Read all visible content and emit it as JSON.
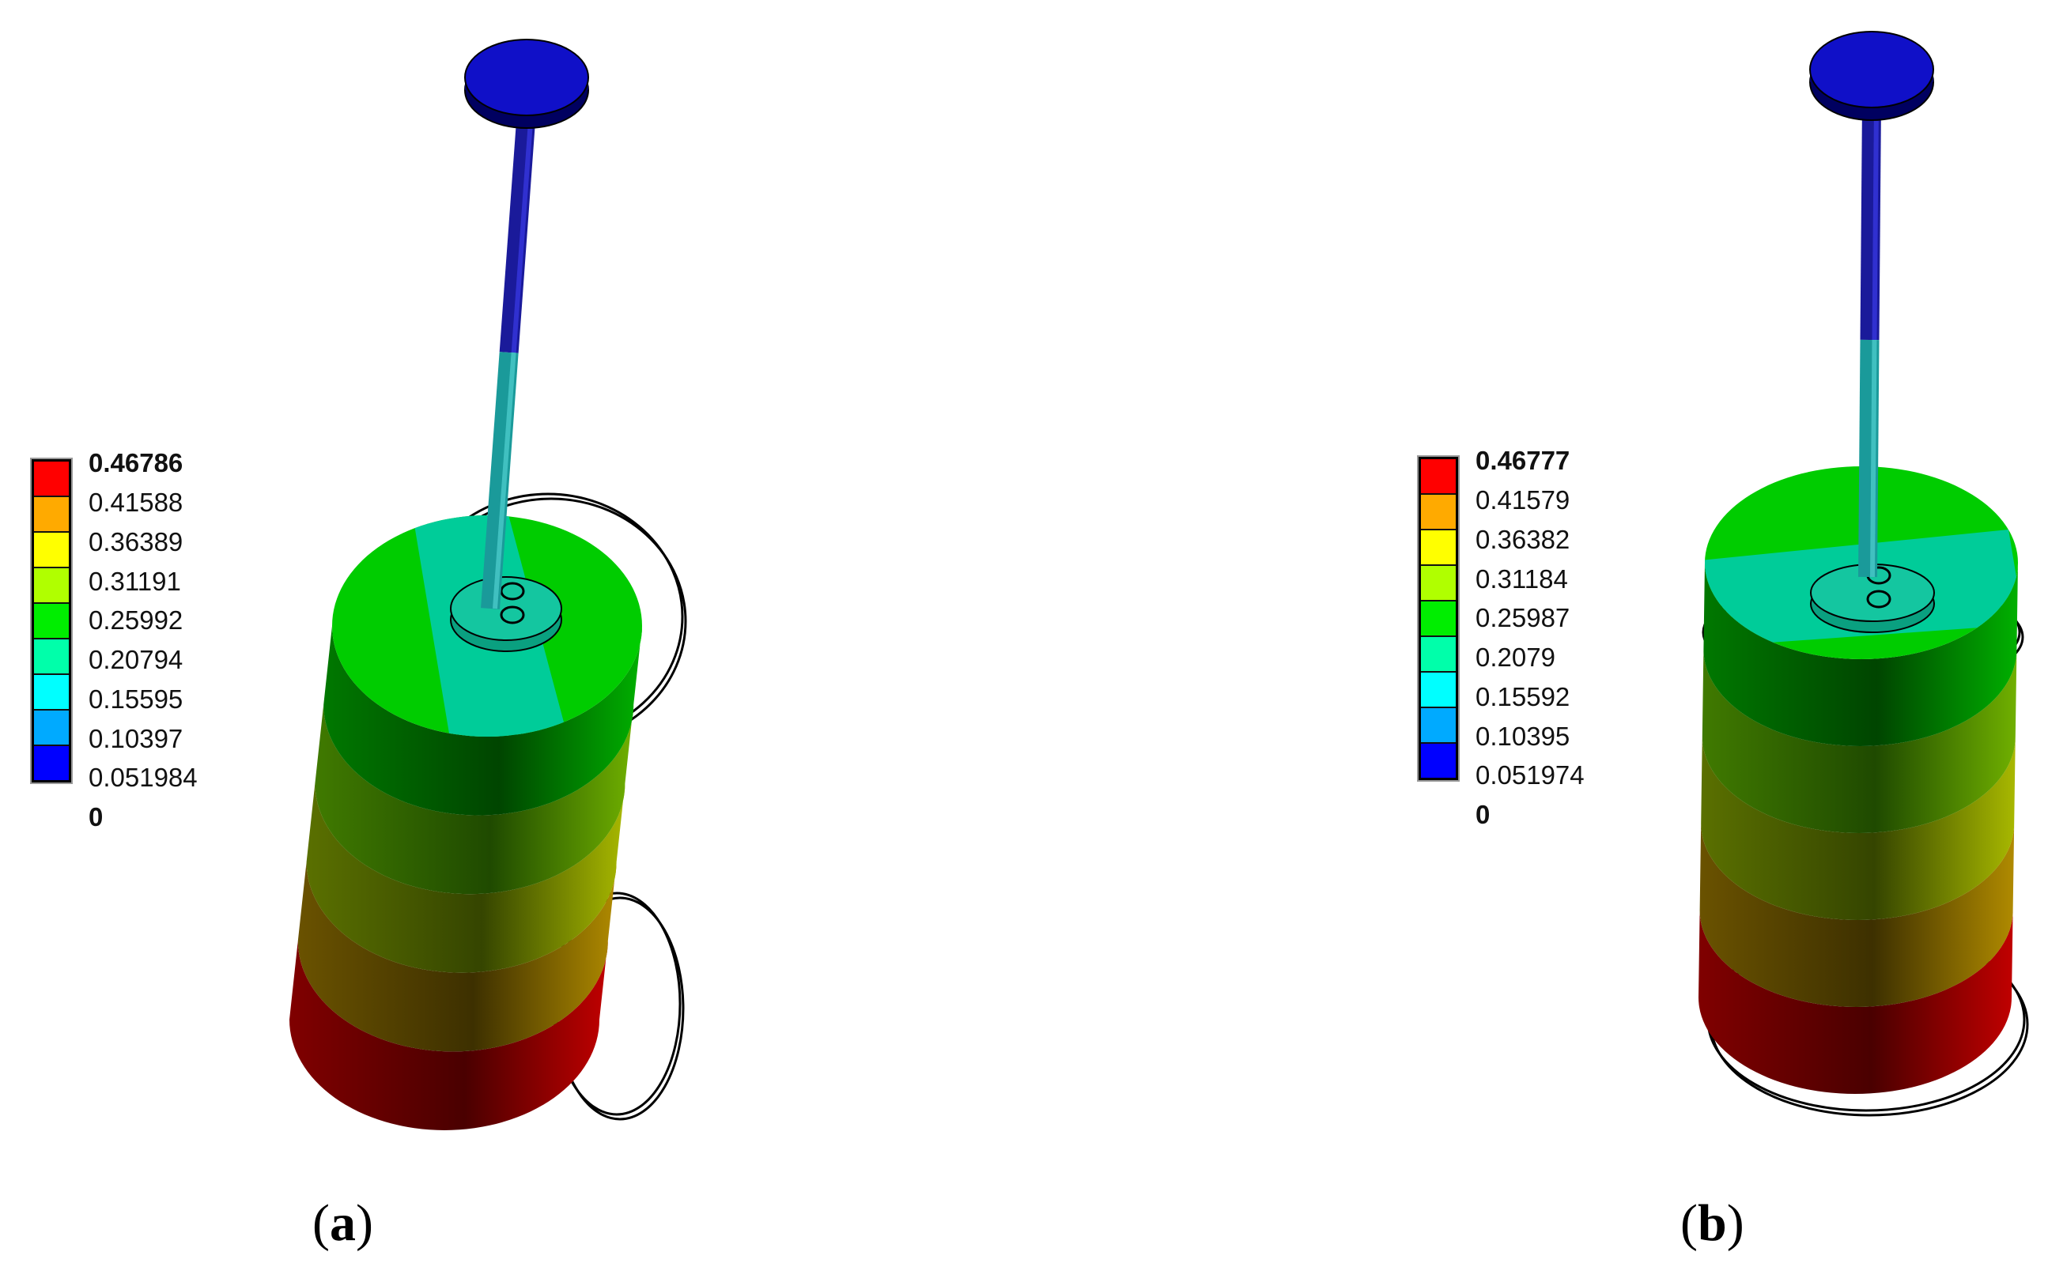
{
  "panels": [
    {
      "id": "a",
      "caption_open": "(",
      "caption_letter": "a",
      "caption_close": ")",
      "legend": [
        "0.46786",
        "0.41588",
        "0.36389",
        "0.31191",
        "0.25992",
        "0.20794",
        "0.15595",
        "0.10397",
        "0.051984",
        "0"
      ]
    },
    {
      "id": "b",
      "caption_open": "(",
      "caption_letter": "b",
      "caption_close": ")",
      "legend": [
        "0.46777",
        "0.41579",
        "0.36382",
        "0.31184",
        "0.25987",
        "0.2079",
        "0.15592",
        "0.10395",
        "0.051974",
        "0"
      ]
    }
  ],
  "colors": {
    "legend_bands": [
      "#ff0000",
      "#ffaa00",
      "#ffff00",
      "#b0ff00",
      "#00ee00",
      "#00ffaa",
      "#00ffff",
      "#00aaff",
      "#0000ff"
    ],
    "knob": "#1010c8",
    "rod_top": "#1a1a9a",
    "rod_bottom": "#1a9a9a",
    "cap_green": "#00cc00",
    "cap_teal": "#00cc99"
  }
}
